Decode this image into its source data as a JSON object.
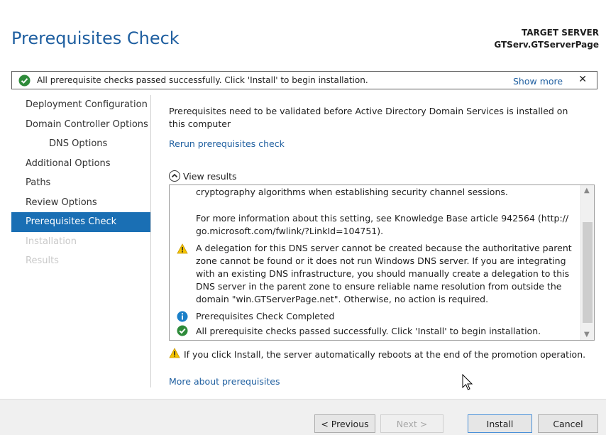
{
  "header": {
    "title": "Prerequisites Check",
    "target_label": "TARGET SERVER",
    "target_value": "GTServ.GTServerPage"
  },
  "banner": {
    "message": "All prerequisite checks passed successfully.  Click 'Install' to begin installation.",
    "show_more": "Show more",
    "close": "✕"
  },
  "sidebar": {
    "items": [
      {
        "label": "Deployment Configuration"
      },
      {
        "label": "Domain Controller Options"
      },
      {
        "label": "DNS Options"
      },
      {
        "label": "Additional Options"
      },
      {
        "label": "Paths"
      },
      {
        "label": "Review Options"
      },
      {
        "label": "Prerequisites Check"
      },
      {
        "label": "Installation"
      },
      {
        "label": "Results"
      }
    ]
  },
  "main": {
    "intro": "Prerequisites need to be validated before Active Directory Domain Services is installed on this computer",
    "rerun_link": "Rerun prerequisites check",
    "view_results": "View results",
    "results": {
      "line1": "cryptography algorithms when establishing security channel sessions.",
      "line2": "For more information about this setting, see Knowledge Base article 942564 (http://",
      "line3": "go.microsoft.com/fwlink/?LinkId=104751).",
      "warn1": "A delegation for this DNS server cannot be created because the authoritative parent",
      "warn2": "zone cannot be found or it does not run Windows DNS server. If you are integrating",
      "warn3": "with an existing DNS infrastructure, you should manually create a delegation to this",
      "warn4": "DNS server in the parent zone to ensure reliable name resolution from outside the",
      "warn5": "domain \"win.GTServerPage.net\". Otherwise, no action is required.",
      "info": "Prerequisites Check Completed",
      "success": "All prerequisite checks passed successfully.  Click 'Install' to begin installation."
    },
    "reboot_warning": "If you click Install, the server automatically reboots at the end of the promotion operation.",
    "more_link": "More about prerequisites"
  },
  "footer": {
    "previous": "< Previous",
    "next": "Next >",
    "install": "Install",
    "cancel": "Cancel"
  },
  "colors": {
    "accent": "#1a6fb4",
    "link": "#1f5fa0",
    "success": "#2e8b3a",
    "warning": "#f5c400",
    "info": "#1a7fc8"
  }
}
